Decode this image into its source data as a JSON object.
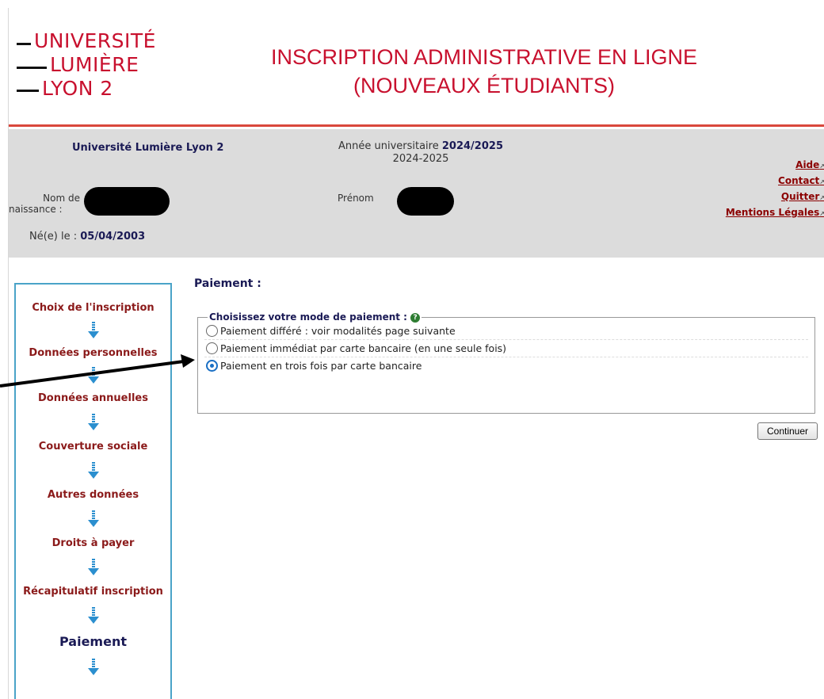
{
  "banner": {
    "logo_words": [
      "UNIVERSITÉ",
      "LUMIÈRE",
      "LYON 2"
    ],
    "title_line1": "INSCRIPTION ADMINISTRATIVE EN LIGNE",
    "title_line2": "(NOUVEAUX ÉTUDIANTS)"
  },
  "info": {
    "university": "Université Lumière Lyon 2",
    "annee_label": "Année universitaire",
    "annee_value": "2024/2025",
    "annee_sub": "2024-2025",
    "nom_label_1": "Nom de",
    "nom_label_2": "naissance :",
    "prenom_label": "Prénom",
    "ne_label": "Né(e) le :",
    "ne_value": "05/04/2003",
    "links": [
      "Aide",
      "Contact",
      "Quitter",
      "Mentions Légales"
    ]
  },
  "nav": {
    "steps": [
      {
        "label": "Choix de l'inscription"
      },
      {
        "label": "Données personnelles"
      },
      {
        "label": "Données annuelles"
      },
      {
        "label": "Couverture sociale"
      },
      {
        "label": "Autres données"
      },
      {
        "label": "Droits à payer"
      },
      {
        "label": "Récapitulatif inscription"
      },
      {
        "label": "Paiement"
      }
    ]
  },
  "main": {
    "title": "Paiement :",
    "legend": "Choisissez votre mode de paiement :",
    "help_icon": "question-icon",
    "options": [
      {
        "label": "Paiement différé : voir modalités page suivante",
        "checked": false
      },
      {
        "label": "Paiement immédiat par carte bancaire (en une seule fois)",
        "checked": false
      },
      {
        "label": "Paiement en trois fois par carte bancaire",
        "checked": true
      }
    ],
    "continue_label": "Continuer"
  },
  "colors": {
    "brand_red": "#c8102e",
    "nav_border": "#4aa3c8",
    "link_red": "#8b0000",
    "title_navy": "#1a1a55"
  }
}
